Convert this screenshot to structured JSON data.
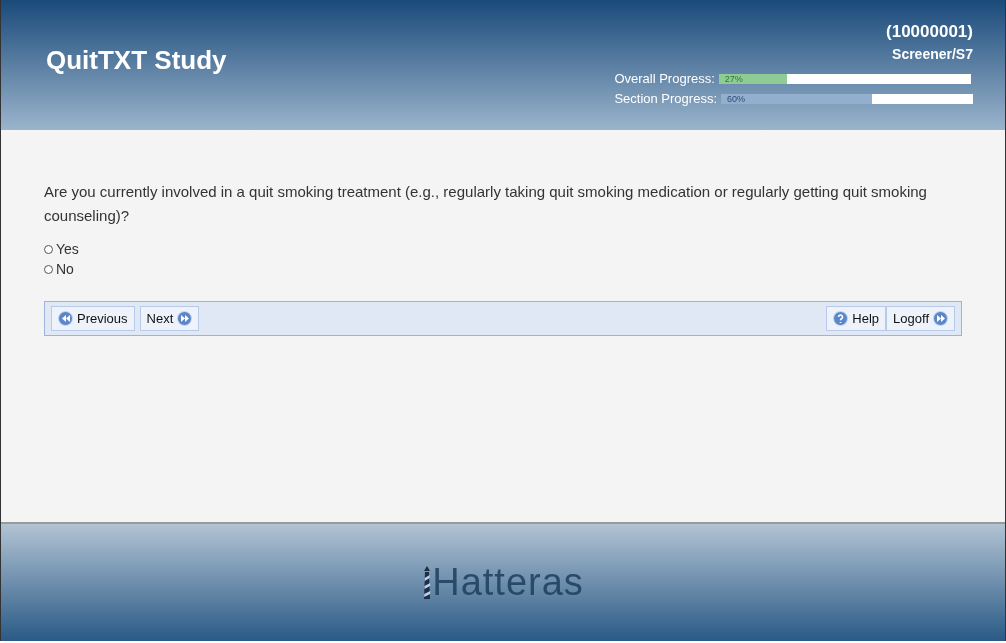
{
  "header": {
    "title": "QuitTXT Study",
    "participant_id": "(10000001)",
    "location": "Screener/S7",
    "progress": [
      {
        "label": "Overall Progress:",
        "level": 0.27,
        "reading": "27%",
        "kind": "overall"
      },
      {
        "label": "Section Progress:",
        "level": 0.6,
        "reading": "60%",
        "kind": "section"
      }
    ]
  },
  "question": {
    "text": "Are you currently involved in a quit smoking treatment (e.g., regularly taking quit smoking medication or regularly getting quit smoking counseling)?",
    "options": [
      {
        "label": "Yes",
        "selected": false
      },
      {
        "label": "No",
        "selected": false
      }
    ]
  },
  "nav": {
    "left": [
      {
        "label": "Previous",
        "kind": "back"
      },
      {
        "label": "Next",
        "kind": "forward"
      }
    ],
    "right": [
      {
        "label": "Help",
        "kind": "help"
      },
      {
        "label": "Logoff",
        "kind": "forward"
      }
    ]
  },
  "footer": {
    "logo": "Hatteras"
  }
}
